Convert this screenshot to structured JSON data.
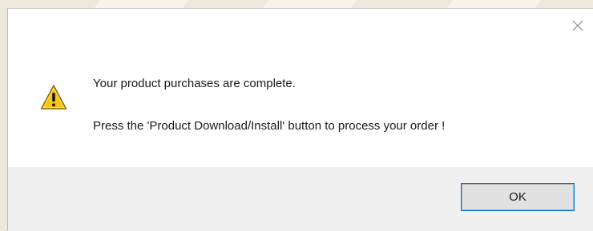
{
  "dialog": {
    "message_line_1": "Your product purchases are complete.",
    "message_line_2": "Press the 'Product Download/Install' button to process your order !",
    "ok_label": "OK",
    "icon": "warning-icon",
    "close_icon": "close-icon"
  },
  "colors": {
    "footer_bg": "#f0f0f0",
    "button_bg": "#e1e1e1",
    "button_focus": "#0078d7",
    "warning_yellow": "#f5c518"
  }
}
